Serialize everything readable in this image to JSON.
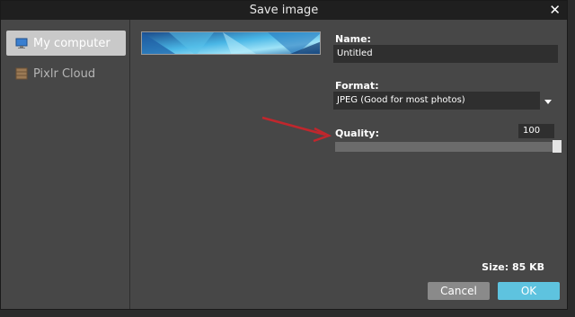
{
  "dialog": {
    "title": "Save image",
    "close_glyph": "✕"
  },
  "sidebar": {
    "items": [
      {
        "label": "My computer",
        "icon": "computer-icon",
        "active": true
      },
      {
        "label": "Pixlr Cloud",
        "icon": "cloud-folder-icon",
        "active": false
      }
    ]
  },
  "form": {
    "name_label": "Name:",
    "name_value": "Untitled",
    "format_label": "Format:",
    "format_value": "JPEG (Good for most photos)",
    "quality_label": "Quality:",
    "quality_value": "100",
    "quality_fraction": 1.0
  },
  "footer": {
    "size_text": "Size: 85 KB",
    "cancel_label": "Cancel",
    "ok_label": "OK"
  },
  "colors": {
    "accent": "#5ec3df",
    "annotation_arrow": "#c0272d"
  }
}
